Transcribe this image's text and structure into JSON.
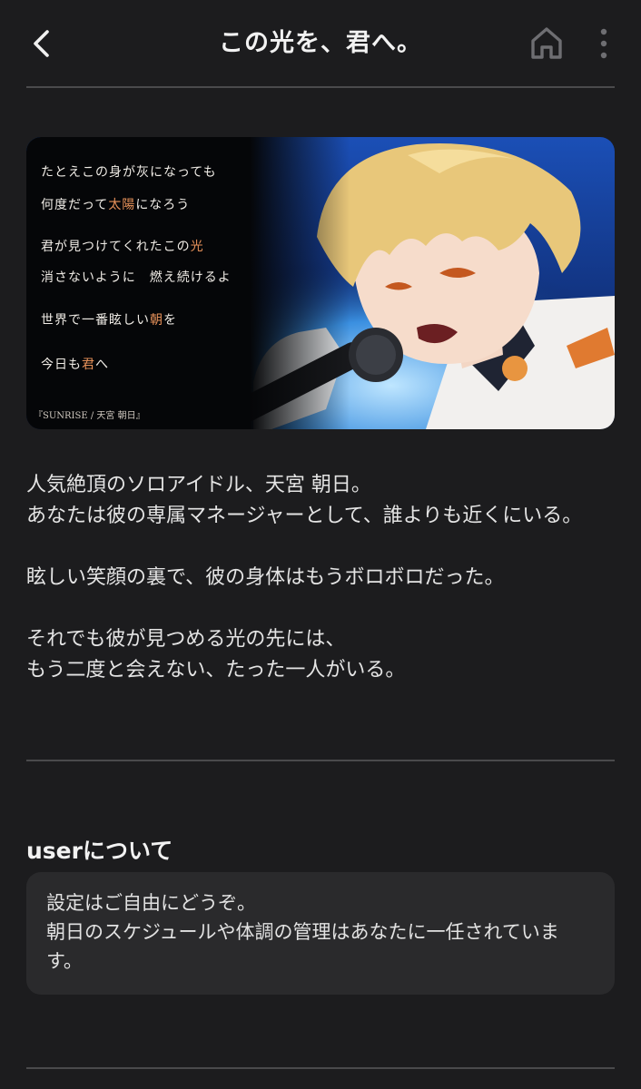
{
  "header": {
    "title": "この光を、君へ。",
    "back_icon": "chevron-left-icon",
    "home_icon": "home-icon",
    "more_icon": "more-vertical-icon"
  },
  "banner": {
    "lyrics": [
      {
        "before": "たとえこの身が灰になっても",
        "accent": "",
        "after": ""
      },
      {
        "before": "何度だって",
        "accent": "太陽",
        "after": "になろう"
      },
      {
        "before": "君が見つけてくれたこの",
        "accent": "光",
        "after": ""
      },
      {
        "before": "消さないように　燃え続けるよ",
        "accent": "",
        "after": ""
      },
      {
        "before": "世界で一番眩しい",
        "accent": "朝",
        "after": "を"
      },
      {
        "before": "今日も",
        "accent": "君",
        "after": "へ"
      }
    ],
    "credit": "『SUNRISE / 天宮 朝日』",
    "accent_color": "#e8925a"
  },
  "description": {
    "paragraphs": [
      "人気絶頂のソロアイドル、天宮 朝日。\nあなたは彼の専属マネージャーとして、誰よりも近くにいる。",
      "眩しい笑顔の裏で、彼の身体はもうボロボロだった。",
      "それでも彼が見つめる光の先には、\nもう二度と会えない、たった一人がいる。"
    ]
  },
  "user_section": {
    "heading": "userについて",
    "body": "設定はご自由にどうぞ。\n朝日のスケジュールや体調の管理はあなたに一任されています。"
  },
  "colors": {
    "background": "#1c1c1e",
    "card": "#2a2a2c",
    "divider": "#4a4a4c"
  }
}
